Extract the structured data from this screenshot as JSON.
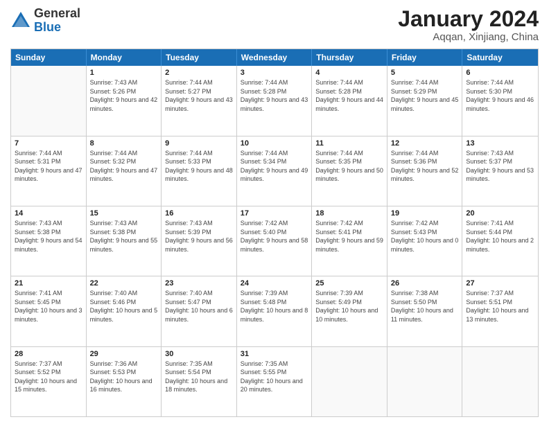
{
  "logo": {
    "general": "General",
    "blue": "Blue"
  },
  "title": "January 2024",
  "location": "Aqqan, Xinjiang, China",
  "days": [
    "Sunday",
    "Monday",
    "Tuesday",
    "Wednesday",
    "Thursday",
    "Friday",
    "Saturday"
  ],
  "rows": [
    [
      {
        "day": "",
        "sunrise": "",
        "sunset": "",
        "daylight": ""
      },
      {
        "day": "1",
        "sunrise": "Sunrise: 7:43 AM",
        "sunset": "Sunset: 5:26 PM",
        "daylight": "Daylight: 9 hours and 42 minutes."
      },
      {
        "day": "2",
        "sunrise": "Sunrise: 7:44 AM",
        "sunset": "Sunset: 5:27 PM",
        "daylight": "Daylight: 9 hours and 43 minutes."
      },
      {
        "day": "3",
        "sunrise": "Sunrise: 7:44 AM",
        "sunset": "Sunset: 5:28 PM",
        "daylight": "Daylight: 9 hours and 43 minutes."
      },
      {
        "day": "4",
        "sunrise": "Sunrise: 7:44 AM",
        "sunset": "Sunset: 5:28 PM",
        "daylight": "Daylight: 9 hours and 44 minutes."
      },
      {
        "day": "5",
        "sunrise": "Sunrise: 7:44 AM",
        "sunset": "Sunset: 5:29 PM",
        "daylight": "Daylight: 9 hours and 45 minutes."
      },
      {
        "day": "6",
        "sunrise": "Sunrise: 7:44 AM",
        "sunset": "Sunset: 5:30 PM",
        "daylight": "Daylight: 9 hours and 46 minutes."
      }
    ],
    [
      {
        "day": "7",
        "sunrise": "Sunrise: 7:44 AM",
        "sunset": "Sunset: 5:31 PM",
        "daylight": "Daylight: 9 hours and 47 minutes."
      },
      {
        "day": "8",
        "sunrise": "Sunrise: 7:44 AM",
        "sunset": "Sunset: 5:32 PM",
        "daylight": "Daylight: 9 hours and 47 minutes."
      },
      {
        "day": "9",
        "sunrise": "Sunrise: 7:44 AM",
        "sunset": "Sunset: 5:33 PM",
        "daylight": "Daylight: 9 hours and 48 minutes."
      },
      {
        "day": "10",
        "sunrise": "Sunrise: 7:44 AM",
        "sunset": "Sunset: 5:34 PM",
        "daylight": "Daylight: 9 hours and 49 minutes."
      },
      {
        "day": "11",
        "sunrise": "Sunrise: 7:44 AM",
        "sunset": "Sunset: 5:35 PM",
        "daylight": "Daylight: 9 hours and 50 minutes."
      },
      {
        "day": "12",
        "sunrise": "Sunrise: 7:44 AM",
        "sunset": "Sunset: 5:36 PM",
        "daylight": "Daylight: 9 hours and 52 minutes."
      },
      {
        "day": "13",
        "sunrise": "Sunrise: 7:43 AM",
        "sunset": "Sunset: 5:37 PM",
        "daylight": "Daylight: 9 hours and 53 minutes."
      }
    ],
    [
      {
        "day": "14",
        "sunrise": "Sunrise: 7:43 AM",
        "sunset": "Sunset: 5:38 PM",
        "daylight": "Daylight: 9 hours and 54 minutes."
      },
      {
        "day": "15",
        "sunrise": "Sunrise: 7:43 AM",
        "sunset": "Sunset: 5:38 PM",
        "daylight": "Daylight: 9 hours and 55 minutes."
      },
      {
        "day": "16",
        "sunrise": "Sunrise: 7:43 AM",
        "sunset": "Sunset: 5:39 PM",
        "daylight": "Daylight: 9 hours and 56 minutes."
      },
      {
        "day": "17",
        "sunrise": "Sunrise: 7:42 AM",
        "sunset": "Sunset: 5:40 PM",
        "daylight": "Daylight: 9 hours and 58 minutes."
      },
      {
        "day": "18",
        "sunrise": "Sunrise: 7:42 AM",
        "sunset": "Sunset: 5:41 PM",
        "daylight": "Daylight: 9 hours and 59 minutes."
      },
      {
        "day": "19",
        "sunrise": "Sunrise: 7:42 AM",
        "sunset": "Sunset: 5:43 PM",
        "daylight": "Daylight: 10 hours and 0 minutes."
      },
      {
        "day": "20",
        "sunrise": "Sunrise: 7:41 AM",
        "sunset": "Sunset: 5:44 PM",
        "daylight": "Daylight: 10 hours and 2 minutes."
      }
    ],
    [
      {
        "day": "21",
        "sunrise": "Sunrise: 7:41 AM",
        "sunset": "Sunset: 5:45 PM",
        "daylight": "Daylight: 10 hours and 3 minutes."
      },
      {
        "day": "22",
        "sunrise": "Sunrise: 7:40 AM",
        "sunset": "Sunset: 5:46 PM",
        "daylight": "Daylight: 10 hours and 5 minutes."
      },
      {
        "day": "23",
        "sunrise": "Sunrise: 7:40 AM",
        "sunset": "Sunset: 5:47 PM",
        "daylight": "Daylight: 10 hours and 6 minutes."
      },
      {
        "day": "24",
        "sunrise": "Sunrise: 7:39 AM",
        "sunset": "Sunset: 5:48 PM",
        "daylight": "Daylight: 10 hours and 8 minutes."
      },
      {
        "day": "25",
        "sunrise": "Sunrise: 7:39 AM",
        "sunset": "Sunset: 5:49 PM",
        "daylight": "Daylight: 10 hours and 10 minutes."
      },
      {
        "day": "26",
        "sunrise": "Sunrise: 7:38 AM",
        "sunset": "Sunset: 5:50 PM",
        "daylight": "Daylight: 10 hours and 11 minutes."
      },
      {
        "day": "27",
        "sunrise": "Sunrise: 7:37 AM",
        "sunset": "Sunset: 5:51 PM",
        "daylight": "Daylight: 10 hours and 13 minutes."
      }
    ],
    [
      {
        "day": "28",
        "sunrise": "Sunrise: 7:37 AM",
        "sunset": "Sunset: 5:52 PM",
        "daylight": "Daylight: 10 hours and 15 minutes."
      },
      {
        "day": "29",
        "sunrise": "Sunrise: 7:36 AM",
        "sunset": "Sunset: 5:53 PM",
        "daylight": "Daylight: 10 hours and 16 minutes."
      },
      {
        "day": "30",
        "sunrise": "Sunrise: 7:35 AM",
        "sunset": "Sunset: 5:54 PM",
        "daylight": "Daylight: 10 hours and 18 minutes."
      },
      {
        "day": "31",
        "sunrise": "Sunrise: 7:35 AM",
        "sunset": "Sunset: 5:55 PM",
        "daylight": "Daylight: 10 hours and 20 minutes."
      },
      {
        "day": "",
        "sunrise": "",
        "sunset": "",
        "daylight": ""
      },
      {
        "day": "",
        "sunrise": "",
        "sunset": "",
        "daylight": ""
      },
      {
        "day": "",
        "sunrise": "",
        "sunset": "",
        "daylight": ""
      }
    ]
  ]
}
